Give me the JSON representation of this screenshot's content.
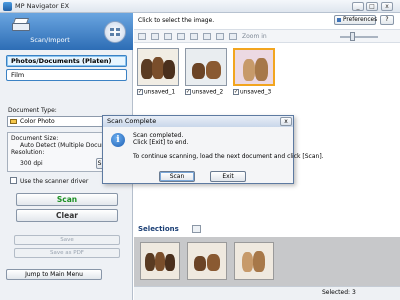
{
  "window": {
    "title": "MP Navigator EX",
    "minimize": "_",
    "maximize": "□",
    "close": "x"
  },
  "sidebar": {
    "title": "Scan/Import",
    "sources": [
      "Photos/Documents (Platen)",
      "Film"
    ],
    "document_type_label": "Document Type:",
    "document_type_value": "Color Photo",
    "document_size_label": "Document Size:",
    "document_size_value": "Auto Detect (Multiple Documents)",
    "resolution_label": "Resolution:",
    "resolution_value": "300 dpi",
    "specify_label": "Specify...",
    "scanner_driver_label": "Use the scanner driver",
    "scan_label": "Scan",
    "clear_label": "Clear",
    "save_label": "Save",
    "save_pdf_label": "Save as PDF",
    "jump_label": "Jump to Main Menu"
  },
  "main": {
    "hint": "Click to select the image.",
    "preferences_label": "Preferences",
    "help_label": "?",
    "zoom_label": "Zoom in",
    "thumbnails": [
      {
        "caption": "unsaved_1",
        "checked": true,
        "selected": false
      },
      {
        "caption": "unsaved_2",
        "checked": true,
        "selected": false
      },
      {
        "caption": "unsaved_3",
        "checked": true,
        "selected": true
      }
    ],
    "selections_label": "Selections"
  },
  "status": {
    "selected_text": "Selected: 3"
  },
  "dialog": {
    "title": "Scan Complete",
    "close": "x",
    "line1": "Scan completed.",
    "line2": "Click [Exit] to end.",
    "line3": "To continue scanning, load the next document and click [Scan].",
    "scan_button": "Scan",
    "exit_button": "Exit"
  },
  "colors": {
    "accent": "#2d6db5",
    "selection_border": "#f2a51f",
    "scan_text": "#1a8f22"
  }
}
